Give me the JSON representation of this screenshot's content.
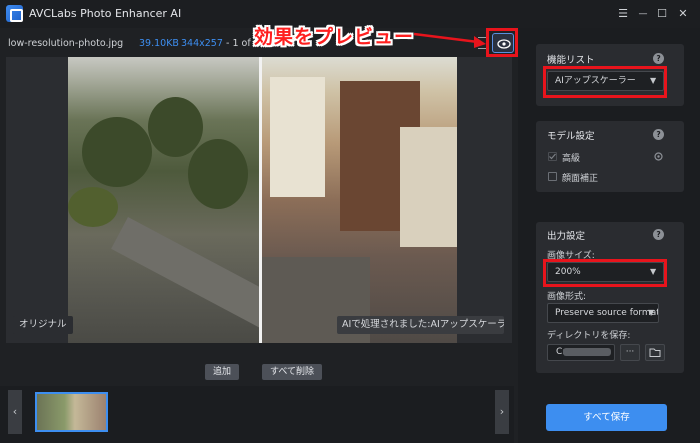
{
  "app": {
    "title": "AVCLabs Photo Enhancer AI"
  },
  "window_controls": {
    "menu": "☰",
    "minimize": "—",
    "maximize": "☐",
    "close": "✕"
  },
  "file_info": {
    "name": "low-resolution-photo.jpg",
    "size": "39.10KB",
    "dimensions": "344x257",
    "count": "- 1 of 1"
  },
  "annotation": {
    "text": "効果をプレビュー"
  },
  "preview": {
    "label_original": "オリジナル",
    "label_processed": "AIで処理されました:AIアップスケーラー"
  },
  "actions": {
    "add": "追加",
    "delete_all": "すべて削除"
  },
  "thumbnail_nav": {
    "prev": "‹",
    "next": "›"
  },
  "feature_list": {
    "title": "機能リスト",
    "selected": "AIアップスケーラー"
  },
  "model_settings": {
    "title": "モデル設定",
    "options": [
      {
        "label": "高級",
        "checked": true
      },
      {
        "label": "顔面補正",
        "checked": false
      }
    ]
  },
  "output_settings": {
    "title": "出力設定",
    "image_size_label": "画像サイズ:",
    "image_size_value": "200%",
    "image_format_label": "画像形式:",
    "image_format_value": "Preserve source format",
    "directory_label": "ディレクトリを保存:",
    "directory_value": "C:",
    "more_button": "···"
  },
  "help_glyph": "?",
  "save_all": "すべて保存",
  "colors": {
    "accent": "#3d8ef0",
    "annotation": "#e8141c",
    "background": "#1f2124",
    "panel": "#2a2c30"
  },
  "icons": [
    "app-logo-icon",
    "menu-icon",
    "minimize-icon",
    "maximize-icon",
    "close-icon",
    "split-view-icon",
    "eye-icon",
    "help-icon",
    "gear-icon",
    "folder-icon",
    "chevron-down-icon",
    "chevron-left-icon",
    "chevron-right-icon"
  ]
}
